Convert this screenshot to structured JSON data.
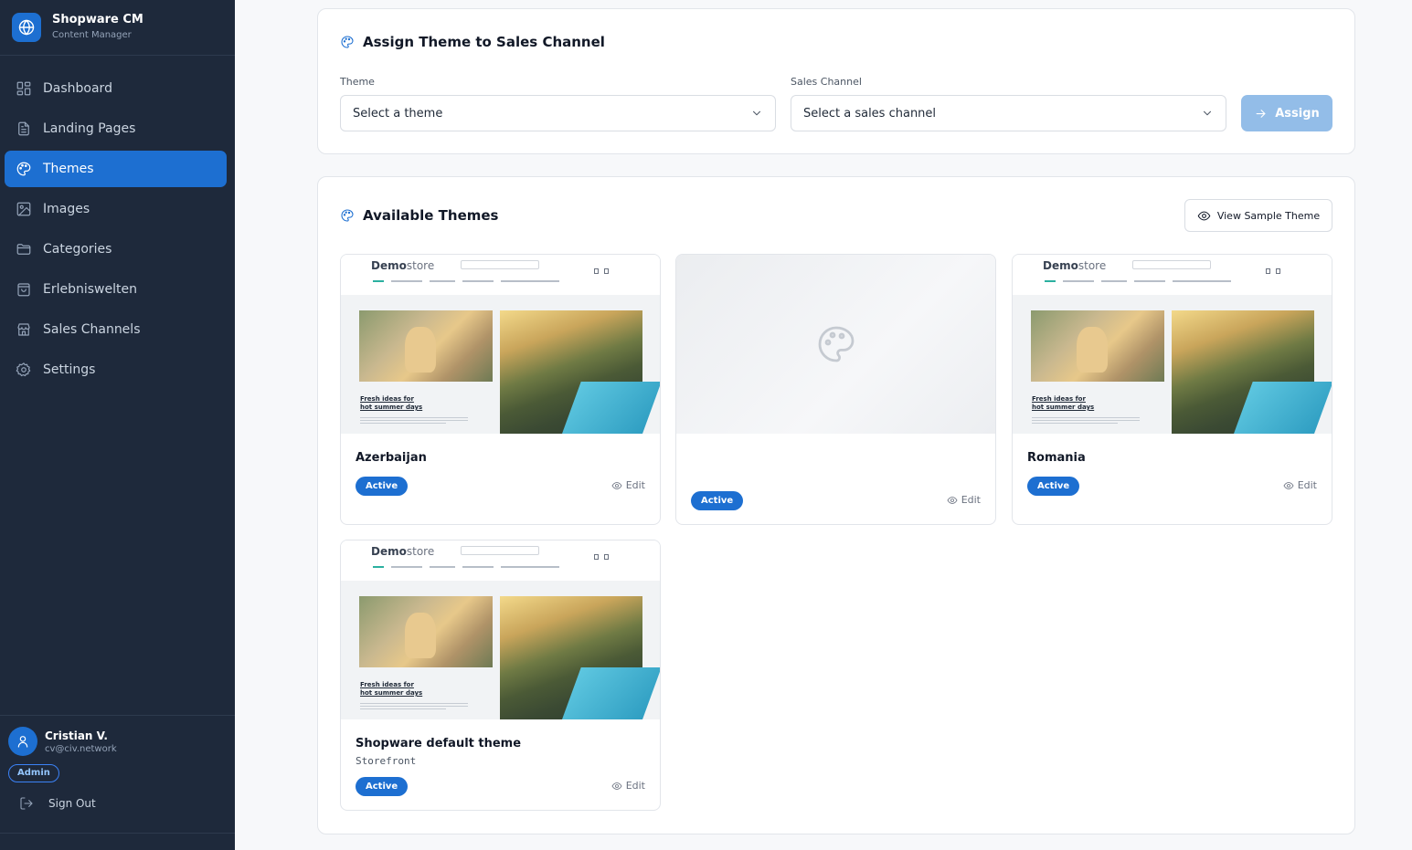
{
  "app": {
    "title": "Shopware CM",
    "subtitle": "Content Manager"
  },
  "sidebar": {
    "items": [
      {
        "label": "Dashboard",
        "icon": "dashboard-icon"
      },
      {
        "label": "Landing Pages",
        "icon": "file-text-icon"
      },
      {
        "label": "Themes",
        "icon": "palette-icon",
        "active": true
      },
      {
        "label": "Images",
        "icon": "image-icon"
      },
      {
        "label": "Categories",
        "icon": "folder-icon"
      },
      {
        "label": "Erlebniswelten",
        "icon": "shopping-bag-icon"
      },
      {
        "label": "Sales Channels",
        "icon": "store-icon"
      },
      {
        "label": "Settings",
        "icon": "gear-icon"
      }
    ]
  },
  "user": {
    "name": "Cristian V.",
    "email": "cv@civ.network",
    "role": "Admin",
    "signout_label": "Sign Out"
  },
  "assign": {
    "title": "Assign Theme to Sales Channel",
    "theme_label": "Theme",
    "theme_value": "Select a theme",
    "channel_label": "Sales Channel",
    "channel_value": "Select a sales channel",
    "button_label": "Assign"
  },
  "themes_section": {
    "title": "Available Themes",
    "view_sample_label": "View Sample Theme",
    "edit_label": "Edit",
    "cards": [
      {
        "name": "Azerbaijan",
        "status": "Active",
        "preview": "demostore-screenshot"
      },
      {
        "name": "",
        "status": "Active",
        "preview": "placeholder-palette"
      },
      {
        "name": "Romania",
        "status": "Active",
        "preview": "demostore-screenshot"
      },
      {
        "name": "Shopware default theme",
        "technical_name": "Storefront",
        "status": "Active",
        "preview": "demostore-screenshot"
      }
    ]
  },
  "preview": {
    "logo_bold": "Demo",
    "logo_light": "store",
    "caption_line1": "Fresh ideas for",
    "caption_line2": "hot summer days"
  },
  "colors": {
    "sidebar_bg": "#1e293b",
    "accent": "#1d6fd1",
    "assign_disabled": "#93bde8",
    "page_bg": "#f7f8fa"
  }
}
